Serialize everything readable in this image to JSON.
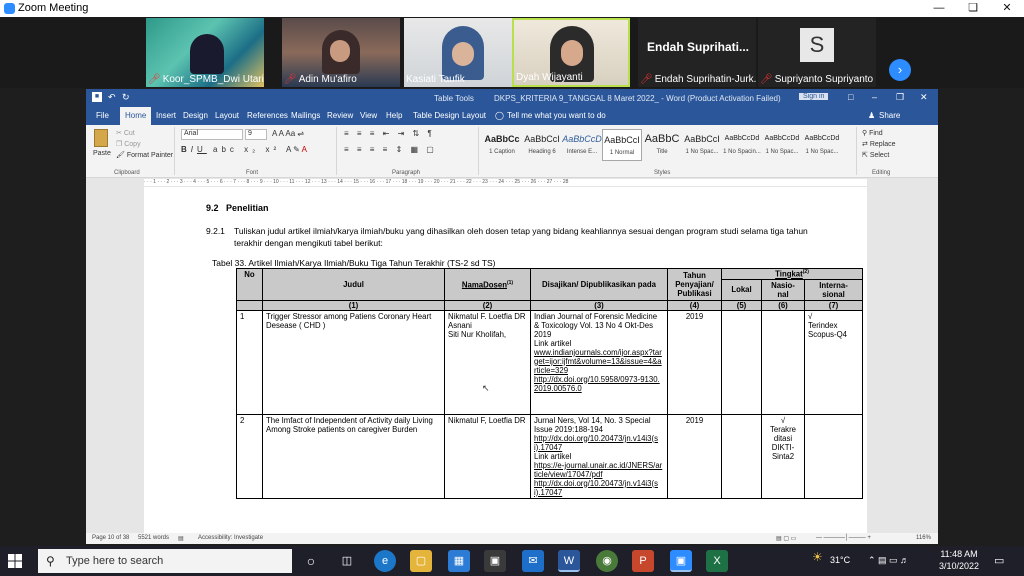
{
  "zoom": {
    "title": "Zoom Meeting"
  },
  "participants": [
    {
      "name": "Koor_SPMB_Dwi Utari..."
    },
    {
      "name": "Adin Mu'afiro"
    },
    {
      "name": "Kasiati Taufik"
    },
    {
      "name": "Dyah Wijayanti"
    },
    {
      "name": "Endah Suprihatin-Jurk...",
      "display": "Endah Suprihati..."
    },
    {
      "name": "Supriyanto Supriyanto",
      "initial": "S"
    }
  ],
  "word": {
    "tab_tools": "Table Tools",
    "doc_title": "DKPS_KRITERIA 9_TANGGAL 8 Maret  2022_ - Word (Product Activation Failed)",
    "sign_in": "Sign in",
    "tabs": [
      "File",
      "Home",
      "Insert",
      "Design",
      "Layout",
      "References",
      "Mailings",
      "Review",
      "View",
      "Help",
      "Table Design",
      "Layout"
    ],
    "tell_me": "Tell me what you want to do",
    "share": "Share",
    "clipboard": {
      "paste": "Paste",
      "cut": "Cut",
      "copy": "Copy",
      "format_painter": "Format Painter",
      "label": "Clipboard"
    },
    "font": {
      "name": "Arial",
      "size": "9",
      "label": "Font"
    },
    "paragraph_label": "Paragraph",
    "styles_label": "Styles",
    "editing": {
      "find": "Find",
      "replace": "Replace",
      "select": "Select",
      "label": "Editing"
    },
    "styles": [
      {
        "preview": "AaBbCc",
        "name": "1 Caption"
      },
      {
        "preview": "AaBbCcI",
        "name": "Heading 6"
      },
      {
        "preview": "AaBbCcD",
        "name": "Intense E..."
      },
      {
        "preview": "AaBbCcI",
        "name": "1 Normal"
      },
      {
        "preview": "AaBbC",
        "name": "Title"
      },
      {
        "preview": "AaBbCcI",
        "name": "1 No Spac..."
      },
      {
        "preview": "AaBbCcDd",
        "name": "1 No Spacin..."
      },
      {
        "preview": "AaBbCcDd",
        "name": "1 No Spac..."
      },
      {
        "preview": "AaBbCcDd",
        "name": "1 No Spac..."
      }
    ],
    "status": {
      "page": "Page 10 of 38",
      "words": "5521 words",
      "accessibility": "Accessibility: Investigate",
      "zoom": "116%"
    }
  },
  "document": {
    "heading_num": "9.2",
    "heading": "Penelitian",
    "para_num": "9.2.1",
    "para_text": "Tuliskan judul artikel ilmiah/karya ilmiah/buku yang dihasilkan oleh dosen tetap yang bidang keahliannya sesuai dengan program studi selama tiga tahun terakhir dengan mengikuti tabel berikut:",
    "table_caption": "Tabel 33. Artikel Ilmiah/Karya Ilmiah/Buku Tiga Tahun Terakhir (TS-2 sd TS)",
    "headers": {
      "no": "No",
      "judul": "Judul",
      "nama_dosen": "NamaDosen",
      "nama_sup": "(1)",
      "disajikan": "Disajikan/ Dipublikasikan pada",
      "tahun": "Tahun Penyajian/ Publikasi",
      "tingkat": "Tingkat",
      "tingkat_sup": "(2)",
      "lokal": "Lokal",
      "nasional": "Nasio- nal",
      "internasional": "Interna- sional"
    },
    "col_numbers": [
      "(1)",
      "(2)",
      "(3)",
      "(4)",
      "(5)",
      "(6)",
      "(7)"
    ],
    "rows": [
      {
        "no": "1",
        "judul": "Trigger Stressor among Patiens Coronary Heart Desease   ( CHD )",
        "dosen": " Nikmatul F. Loetfia DR\nAsnani\nSiti Nur Kholifah,",
        "pub_text": "Indian Journal of Forensic Medicine & Toxicology Vol. 13 No 4 Okt-Des 2019\nLink artikel",
        "pub_link1": "www.indianjournals.com/ijor.aspx?target=ijor:ijfmt&volume=13&issue=4&article=329",
        "pub_link2": "http://dx.doi.org/10.5958/0973-9130.2019.00576.0",
        "tahun": "2019",
        "lokal": "",
        "nasional": "",
        "internasional": "√\nTerindex Scopus-Q4"
      },
      {
        "no": "2",
        "judul": "The Imfact of Independent of Activity daily Living Among Stroke patients on caregiver Burden",
        "dosen": "Nikmatul F, Loetfia DR",
        "pub_text": "Jurnal Ners, Vol 14, No. 3 Special Issue 2019:188-194",
        "pub_link1": "http://dx.doi.org/10.20473/jn.v14i3(si).17047",
        "pub_text2": "Link artikel",
        "pub_link2": "https://e-journal.unair.ac.id/JNERS/article/view/17047/pdf",
        "pub_link3": "http://dx.doi.org/10.20473/jn.v14i3(si).17047",
        "tahun": "2019",
        "lokal": "",
        "nasional": "√\nTerakre ditasi DIKTI- Sinta2",
        "internasional": ""
      }
    ]
  },
  "taskbar": {
    "search_placeholder": "Type here to search",
    "temperature": "31°C",
    "time": "11:48 AM",
    "date": "3/10/2022"
  }
}
